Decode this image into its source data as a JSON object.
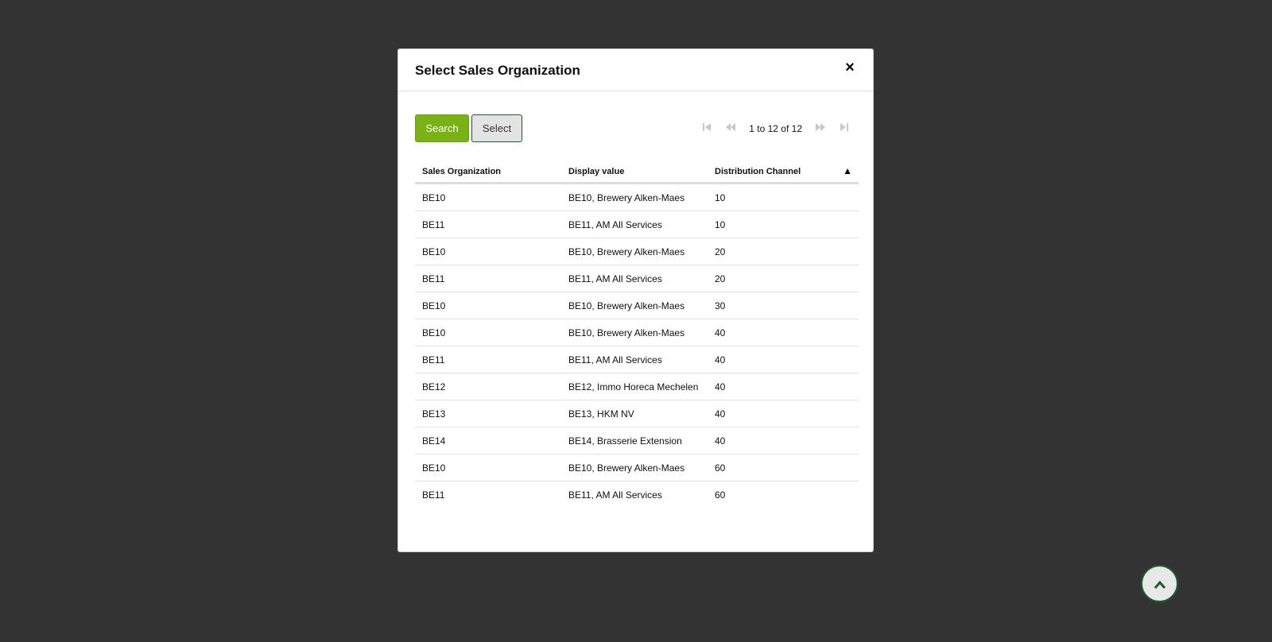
{
  "dialog": {
    "title": "Select Sales Organization",
    "close_label": "×"
  },
  "toolbar": {
    "search_label": "Search",
    "select_label": "Select"
  },
  "pager": {
    "first_icon": "first-page-icon",
    "prev_icon": "previous-page-icon",
    "text": "1 to 12 of 12",
    "next_icon": "next-page-icon",
    "last_icon": "last-page-icon"
  },
  "table": {
    "columns": [
      "Sales Organization",
      "Display value",
      "Distribution Channel"
    ],
    "sort_indicator": "▲",
    "rows": [
      [
        "BE10",
        "BE10, Brewery Alken-Maes",
        "10"
      ],
      [
        "BE11",
        "BE11, AM All Services",
        "10"
      ],
      [
        "BE10",
        "BE10, Brewery Alken-Maes",
        "20"
      ],
      [
        "BE11",
        "BE11, AM All Services",
        "20"
      ],
      [
        "BE10",
        "BE10, Brewery Alken-Maes",
        "30"
      ],
      [
        "BE10",
        "BE10, Brewery Alken-Maes",
        "40"
      ],
      [
        "BE11",
        "BE11, AM All Services",
        "40"
      ],
      [
        "BE12",
        "BE12, Immo Horeca Mechelen",
        "40"
      ],
      [
        "BE13",
        "BE13, HKM NV",
        "40"
      ],
      [
        "BE14",
        "BE14, Brasserie Extension",
        "40"
      ],
      [
        "BE10",
        "BE10, Brewery Alken-Maes",
        "60"
      ],
      [
        "BE11",
        "BE11, AM All Services",
        "60"
      ]
    ]
  },
  "scroll_top": {
    "icon": "chevron-up-icon"
  },
  "colors": {
    "backdrop": "#333333",
    "accent": "#78b214",
    "dark_green": "#1d5c2c"
  }
}
